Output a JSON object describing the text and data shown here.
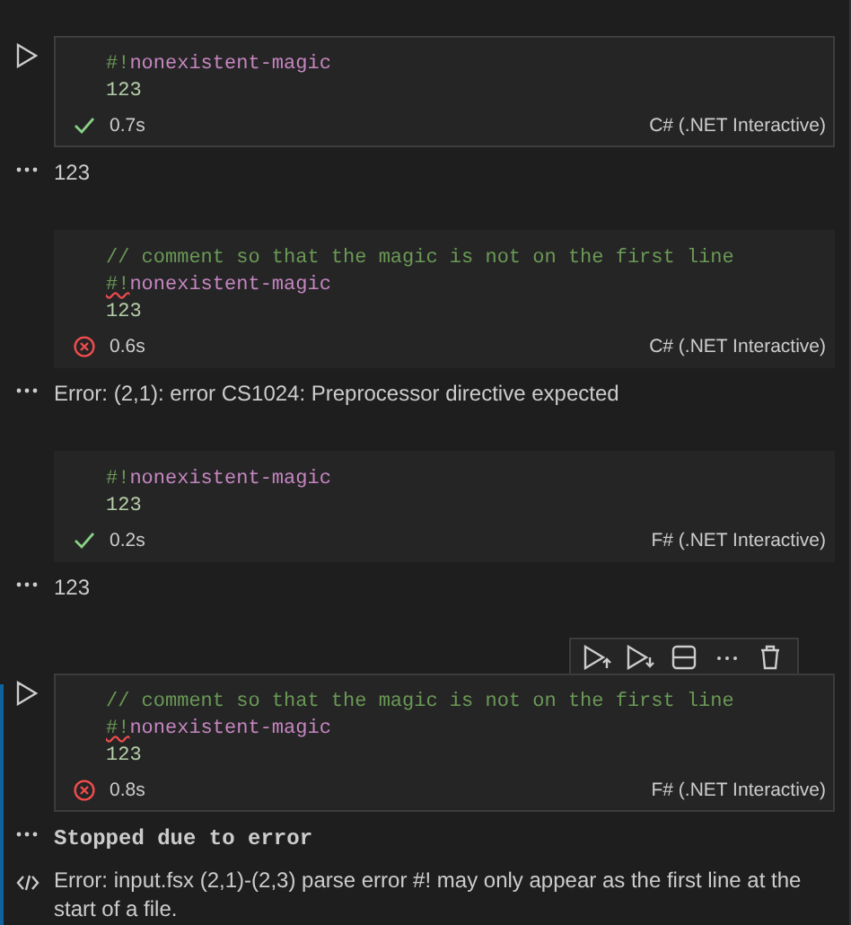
{
  "cells": [
    {
      "hovered": true,
      "focused": false,
      "lines": [
        [
          {
            "text": "#!",
            "kind": "directive",
            "error": false
          },
          {
            "text": "nonexistent-magic",
            "kind": "magic",
            "error": false
          }
        ],
        [
          {
            "text": "123",
            "kind": "number",
            "error": false
          }
        ]
      ],
      "failed": false,
      "time": "0.7s",
      "language": "C# (.NET Interactive)",
      "outputs": [
        {
          "kind": "text",
          "text": "123"
        }
      ]
    },
    {
      "hovered": false,
      "focused": false,
      "lines": [
        [
          {
            "text": "// comment so that the magic is not on the first line",
            "kind": "comment",
            "error": false
          }
        ],
        [
          {
            "text": "#!",
            "kind": "directive",
            "error": true
          },
          {
            "text": "nonexistent-magic",
            "kind": "magic",
            "error": false
          }
        ],
        [
          {
            "text": "123",
            "kind": "number",
            "error": false
          }
        ]
      ],
      "failed": true,
      "time": "0.6s",
      "language": "C# (.NET Interactive)",
      "outputs": [
        {
          "kind": "text",
          "text": "Error: (2,1): error CS1024: Preprocessor directive expected"
        }
      ]
    },
    {
      "hovered": false,
      "focused": false,
      "lines": [
        [
          {
            "text": "#!",
            "kind": "directive",
            "error": false
          },
          {
            "text": "nonexistent-magic",
            "kind": "magic",
            "error": false
          }
        ],
        [
          {
            "text": "123",
            "kind": "number",
            "error": false
          }
        ]
      ],
      "failed": false,
      "time": "0.2s",
      "language": "F# (.NET Interactive)",
      "outputs": [
        {
          "kind": "text",
          "text": "123"
        }
      ]
    },
    {
      "hovered": true,
      "focused": true,
      "lines": [
        [
          {
            "text": "// comment so that the magic is not on the first line",
            "kind": "comment",
            "error": false
          }
        ],
        [
          {
            "text": "#!",
            "kind": "directive",
            "error": true
          },
          {
            "text": "nonexistent-magic",
            "kind": "magic",
            "error": false
          }
        ],
        [
          {
            "text": "123",
            "kind": "number",
            "error": false
          }
        ]
      ],
      "failed": true,
      "time": "0.8s",
      "language": "F# (.NET Interactive)",
      "outputs": [
        {
          "kind": "mono",
          "text": "Stopped due to error"
        },
        {
          "kind": "html",
          "text": "Error: input.fsx (2,1)-(2,3) parse error #! may only appear as the first line at the start of a file."
        }
      ]
    }
  ]
}
